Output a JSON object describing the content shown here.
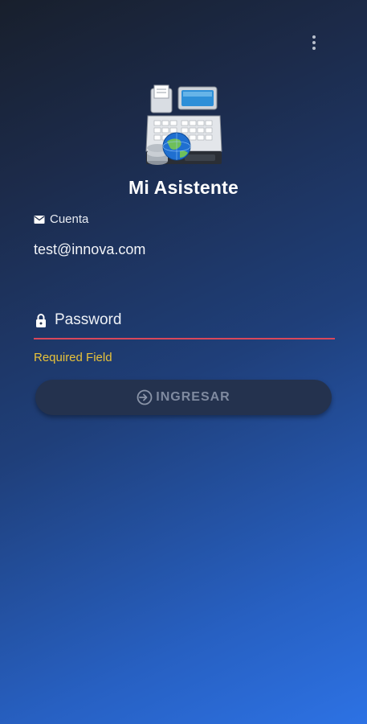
{
  "app": {
    "title": "Mi Asistente"
  },
  "menu": {
    "icon": "more-vert-icon"
  },
  "account": {
    "label": "Cuenta",
    "value": "test@innova.com",
    "icon": "mail-icon"
  },
  "password": {
    "placeholder": "Password",
    "icon": "lock-icon",
    "error": "Required Field"
  },
  "login": {
    "label": "INGRESAR",
    "icon": "login-icon"
  },
  "colors": {
    "error_line": "#d9475a",
    "error_text": "#e8c23a",
    "button_bg": "#24324e",
    "button_text": "#7f8aa0"
  }
}
